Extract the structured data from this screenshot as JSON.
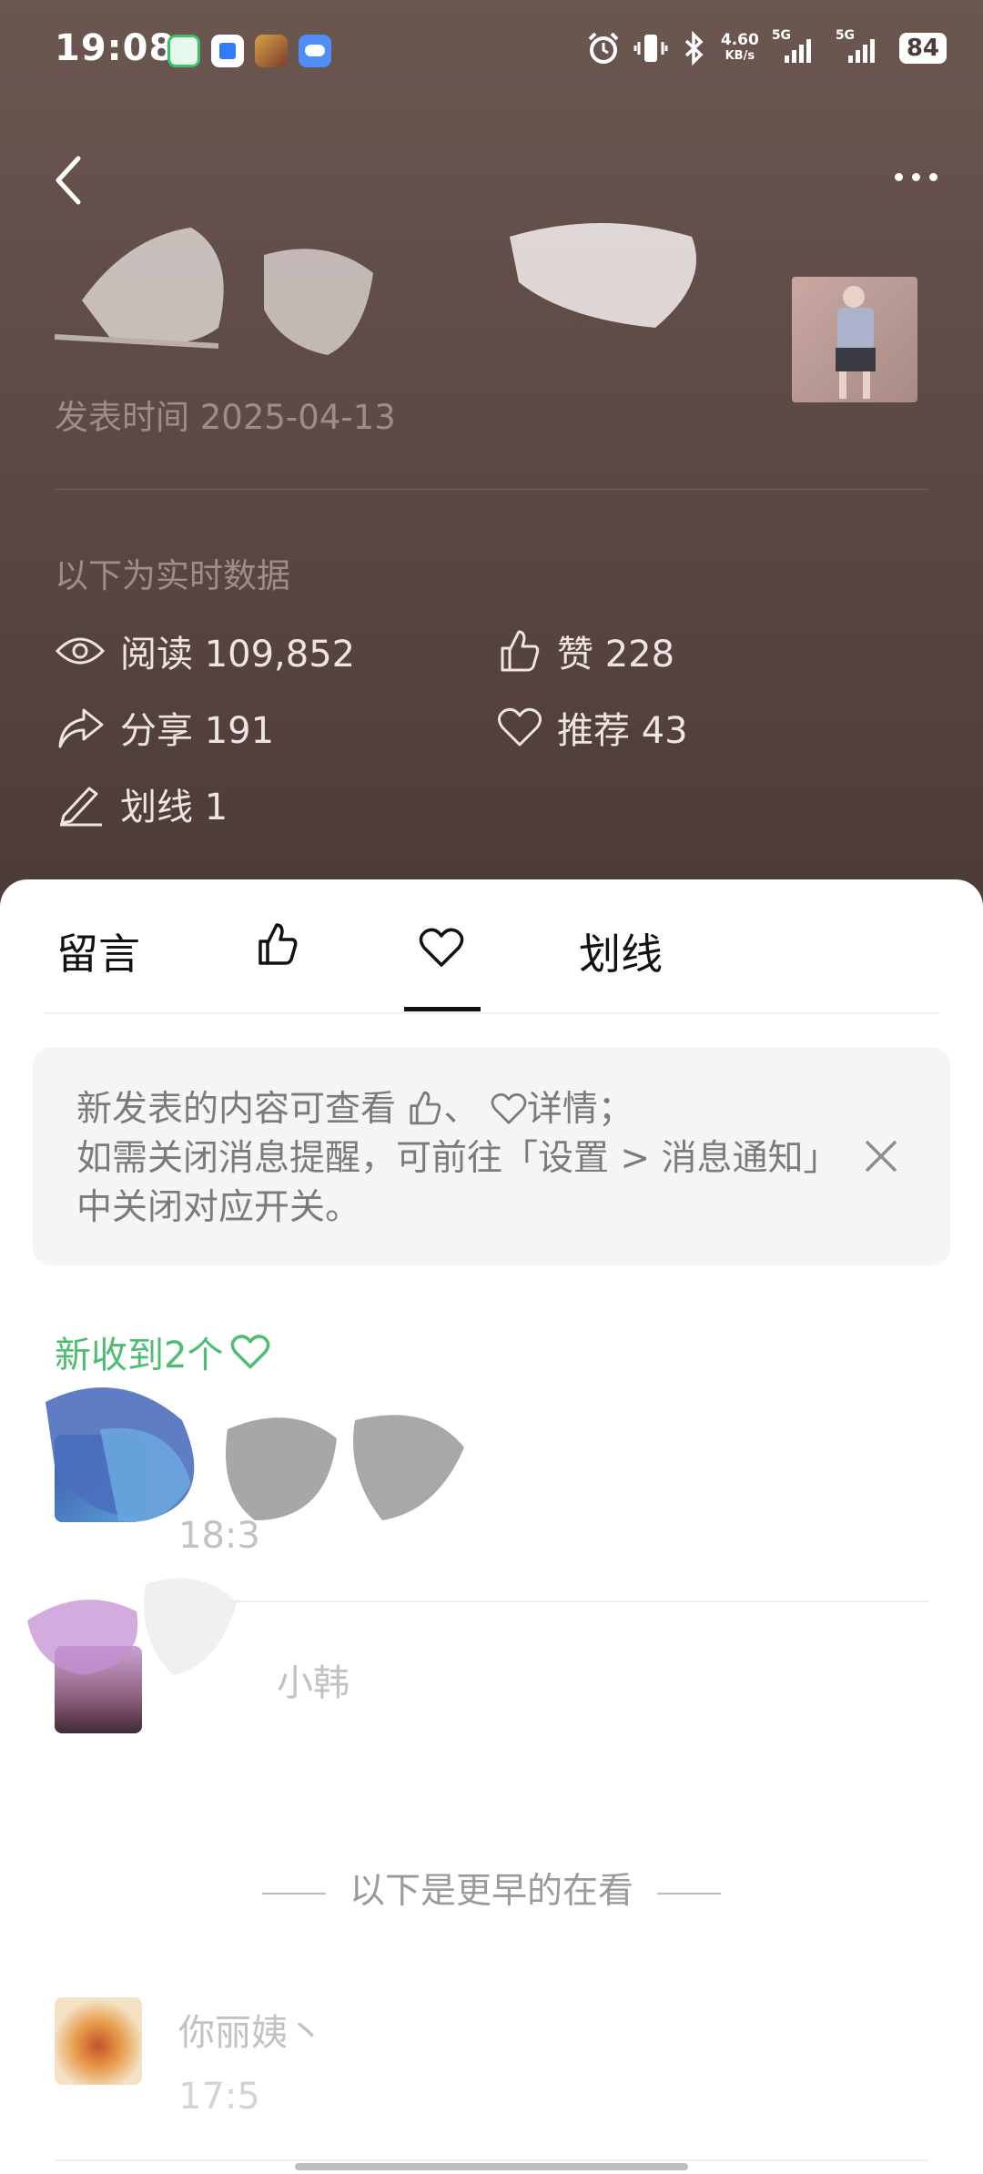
{
  "status_bar": {
    "time": "19:08",
    "net_speed_value": "4.60",
    "net_speed_unit": "KB/s",
    "signal1_label": "5G",
    "signal2_label": "5G",
    "battery": "84"
  },
  "header": {
    "publish_time": "发表时间 2025-04-13",
    "realtime_label": "以下为实时数据"
  },
  "stats": {
    "read": "阅读 109,852",
    "like": "赞 228",
    "share": "分享 191",
    "recommend": "推荐 43",
    "highlight": "划线 1"
  },
  "tabs": {
    "comments": "留言",
    "highlight": "划线"
  },
  "notice": {
    "line1_a": "新发表的内容可查看",
    "line1_b": "、",
    "line1_c": "详情；",
    "line2": "如需关闭消息提醒，可前往「设置 > 消息通知」中关闭对应开关。"
  },
  "list": {
    "new_received": "新收到2个",
    "row1_time": "18:3",
    "row2_name": "小韩",
    "earlier_label": "以下是更早的在看",
    "row3_name": "你丽姨丶",
    "row3_time": "17:5"
  },
  "colors": {
    "header_bg": "#5e4a45",
    "accent_green": "#4dbd71"
  }
}
